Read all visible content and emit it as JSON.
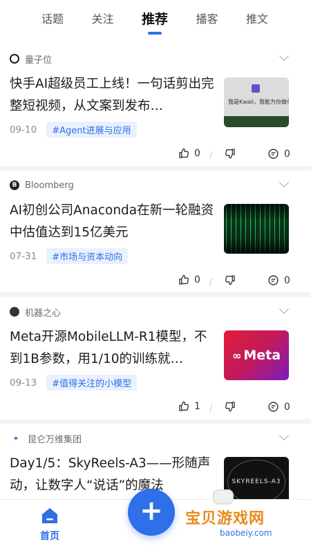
{
  "tabs": [
    "话题",
    "关注",
    "推荐",
    "播客",
    "推文"
  ],
  "active_tab": "推荐",
  "feed": [
    {
      "source": "量子位",
      "title": "快手AI超级员工上线！一句话剪出完整短视频，从文案到发布…",
      "date": "09-10",
      "tag": "#Agent进展与应用",
      "likes": "0",
      "comments": "0",
      "thumb_text": "我是Kwali，我能为你做什…"
    },
    {
      "source": "Bloomberg",
      "title": "AI初创公司Anaconda在新一轮融资中估值达到15亿美元",
      "date": "07-31",
      "tag": "#市场与资本动向",
      "likes": "0",
      "comments": "0"
    },
    {
      "source": "机器之心",
      "title": "Meta开源MobileLLM-R1模型，不到1B参数，用1/10的训练就…",
      "date": "09-13",
      "tag": "#值得关注的小模型",
      "likes": "1",
      "comments": "0",
      "thumb_text": "Meta"
    },
    {
      "source": "昆仑万维集团",
      "title": "Day1/5：SkyReels-A3——形随声动，让数字人“说话”的魔法",
      "thumb_text": "SKYREELS-A3"
    }
  ],
  "bottom_nav": {
    "home_label": "首页",
    "fab_label": "+"
  },
  "watermark": {
    "title": "宝贝游戏网",
    "url": "baobeiy.com"
  },
  "colors": {
    "accent": "#2f6fe8",
    "tag_bg": "#eaf1fd"
  }
}
